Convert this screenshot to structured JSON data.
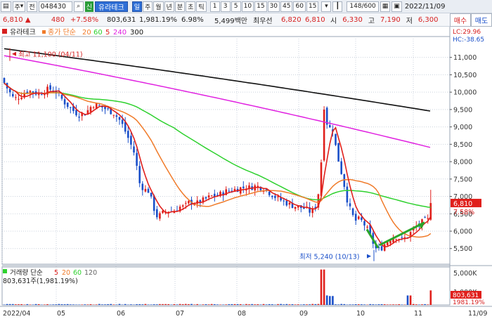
{
  "toolbar": {
    "icons": [
      "chart-toggle-icon",
      "market-select",
      "prev-icon"
    ],
    "market_label": "주",
    "prev_label": "전",
    "code": "048430",
    "search_icon": "search-icon",
    "type_badge": "신",
    "stock_name": "유라테크",
    "period_buttons": [
      "일",
      "주",
      "월",
      "년",
      "분",
      "초",
      "틱"
    ],
    "minute_buttons": [
      "1",
      "3",
      "5",
      "10",
      "15",
      "30",
      "45",
      "60",
      "15"
    ],
    "counter": "148/600",
    "date": "2022/11/09"
  },
  "quote": {
    "price": "6,810",
    "arrow": "▲",
    "change": "480",
    "change_pct": "+7.58%",
    "volume": "803,631",
    "volume_pct": "1,981.19%",
    "turnover": "6.98%",
    "amount": "5,499백만",
    "best_ask_label": "최우선",
    "best_ask": "6,820",
    "best_bid": "6,810",
    "open_label": "시",
    "open": "6,330",
    "high_label": "고",
    "high": "7,190",
    "low_label": "저",
    "low": "6,300",
    "buy_label": "매수",
    "sell_label": "매도"
  },
  "legend": {
    "name": "유라테크",
    "series": "종가 단순",
    "ma1": "20",
    "ma2": "60",
    "ma3": "5",
    "ma4": "240",
    "ma5": "300"
  },
  "price_axis": {
    "lc": "LC:29.96",
    "hc": "HC:-38.65",
    "ticks": [
      "11,000",
      "10,500",
      "10,000",
      "9,500",
      "9,000",
      "8,500",
      "8,000",
      "7,500",
      "7,000",
      "6,500",
      "6,000",
      "5,500"
    ],
    "current_price": "6,810",
    "current_pct": "7.58%"
  },
  "annotations": {
    "high": "최고 11,100 (04/11)",
    "low": "최저 5,240 (10/13)"
  },
  "volume_legend": {
    "title": "거래량 단순",
    "ma1": "5",
    "ma2": "20",
    "ma3": "60",
    "ma4": "120",
    "current": "803,631주(1,981.19%)"
  },
  "volume_axis": {
    "ticks": [
      "5,000K",
      "1,000K"
    ],
    "current": "803,631",
    "current_pct": "1981.19%"
  },
  "x_axis": {
    "labels": [
      "2022/04",
      "05",
      "06",
      "07",
      "08",
      "09",
      "10",
      "11",
      "11/09"
    ]
  },
  "colors": {
    "up": "#e0201c",
    "down": "#1a4fc9",
    "ma5": "#e0201c",
    "ma20": "#f07b2a",
    "ma60": "#2ed12e",
    "ma240": "#e020e0",
    "ma300": "#111111",
    "trend_arrow": "#2aa52a"
  }
}
